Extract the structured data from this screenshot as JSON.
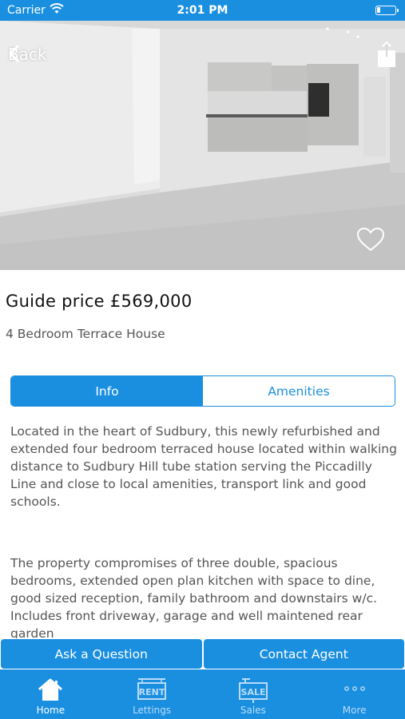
{
  "status_bar": {
    "carrier": "Carrier",
    "time": "2:01 PM",
    "battery_level": 0.2
  },
  "header": {
    "back_label": "Back",
    "back_icon": "chevron-left-icon",
    "share_icon": "share-icon",
    "favorite_icon": "heart-outline-icon"
  },
  "listing": {
    "price": "Guide price £569,000",
    "property_type": "4 Bedroom Terrace House"
  },
  "tabs": [
    {
      "label": "Info",
      "selected": true
    },
    {
      "label": "Amenities",
      "selected": false
    }
  ],
  "description": {
    "paragraph_1": "Located in the heart of Sudbury, this newly refurbished and extended four bedroom terraced house located within walking distance to Sudbury Hill  tube station serving the Piccadilly Line and close to local amenities, transport link and good schools.",
    "paragraph_2": "The property compromises of three double, spacious bedrooms, extended open plan kitchen with space to dine, good sized reception, family bathroom and downstairs w/c. Includes front driveway, garage and well maintened rear garden"
  },
  "actions": {
    "ask_label": "Ask a Question",
    "contact_label": "Contact Agent"
  },
  "tab_bar": {
    "items": [
      {
        "label": "Home",
        "icon": "home-icon",
        "active": true
      },
      {
        "label": "Lettings",
        "icon": "rent-sign-icon",
        "icon_text": "RENT",
        "active": false
      },
      {
        "label": "Sales",
        "icon": "sale-sign-icon",
        "icon_text": "SALE",
        "active": false
      },
      {
        "label": "More",
        "icon": "more-dots-icon",
        "active": false
      }
    ]
  },
  "colors": {
    "primary": "#1a8fe0",
    "text_dark": "#111111",
    "text_muted": "#555555"
  }
}
